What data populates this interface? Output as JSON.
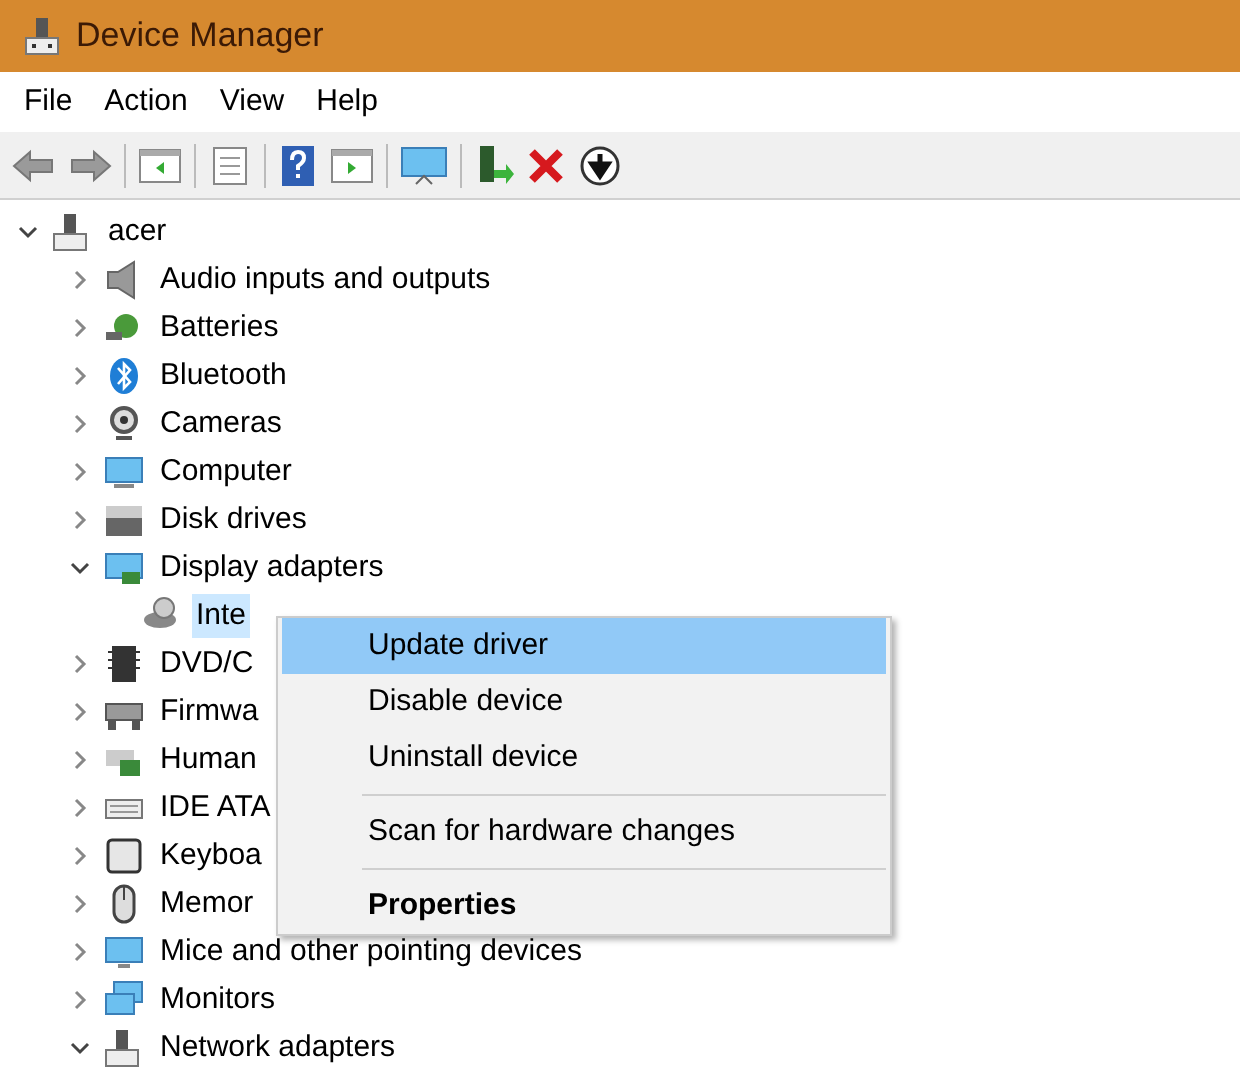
{
  "window": {
    "title": "Device Manager"
  },
  "menu_bar": [
    "File",
    "Action",
    "View",
    "Help"
  ],
  "tree": {
    "label": "acer",
    "expanded": true,
    "children": [
      {
        "label": "Audio inputs and outputs",
        "expanded": false,
        "selected": false
      },
      {
        "label": "Batteries",
        "expanded": false,
        "selected": false
      },
      {
        "label": "Bluetooth",
        "expanded": false,
        "selected": false
      },
      {
        "label": "Cameras",
        "expanded": false,
        "selected": false
      },
      {
        "label": "Computer",
        "expanded": false,
        "selected": false
      },
      {
        "label": "Disk drives",
        "expanded": false,
        "selected": false
      },
      {
        "label": "Display adapters",
        "expanded": true,
        "selected": false,
        "children": [
          {
            "label": "Inte",
            "selected": true
          }
        ]
      },
      {
        "label": "DVD/C",
        "expanded": false,
        "selected": false
      },
      {
        "label": "Firmwa",
        "expanded": false,
        "selected": false
      },
      {
        "label": "Human",
        "expanded": false,
        "selected": false
      },
      {
        "label": "IDE ATA",
        "expanded": false,
        "selected": false
      },
      {
        "label": "Keyboa",
        "expanded": false,
        "selected": false
      },
      {
        "label": "Memor",
        "expanded": false,
        "selected": false
      },
      {
        "label": "Mice and other pointing devices",
        "expanded": false,
        "selected": false
      },
      {
        "label": "Monitors",
        "expanded": false,
        "selected": false
      },
      {
        "label": "Network adapters",
        "expanded": true,
        "selected": false
      }
    ]
  },
  "context_menu": [
    {
      "kind": "item",
      "label": "Update driver",
      "selected": true,
      "default": false
    },
    {
      "kind": "item",
      "label": "Disable device",
      "selected": false,
      "default": false
    },
    {
      "kind": "item",
      "label": "Uninstall device",
      "selected": false,
      "default": false
    },
    {
      "kind": "separator"
    },
    {
      "kind": "item",
      "label": "Scan for hardware changes",
      "selected": false,
      "default": false
    },
    {
      "kind": "separator"
    },
    {
      "kind": "item",
      "label": "Properties",
      "selected": false,
      "default": true
    }
  ]
}
